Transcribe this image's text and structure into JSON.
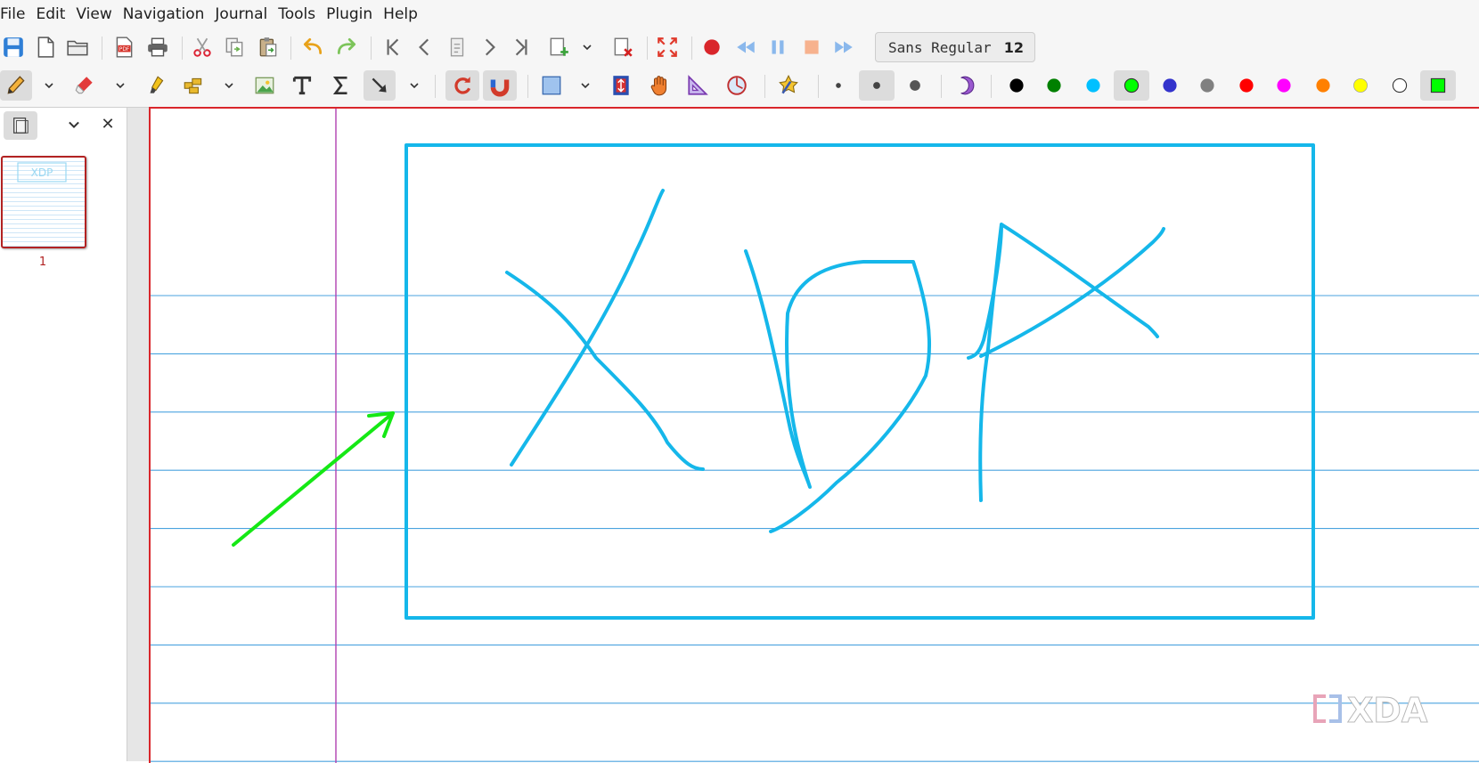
{
  "menu": [
    "File",
    "Edit",
    "View",
    "Navigation",
    "Journal",
    "Tools",
    "Plugin",
    "Help"
  ],
  "toolbar_main": {
    "buttons": [
      "save-icon",
      "new-document-icon",
      "open-folder-icon",
      "export-pdf-icon",
      "print-icon",
      "cut-icon",
      "copy-icon",
      "paste-icon",
      "undo-icon",
      "redo-icon",
      "first-page-icon",
      "previous-page-icon",
      "goto-page-icon",
      "next-page-icon",
      "last-page-icon",
      "add-page-icon",
      "delete-page-icon",
      "fullscreen-icon",
      "record-icon",
      "rewind-icon",
      "pause-icon",
      "stop-icon",
      "fast-forward-icon"
    ],
    "font_name": "Sans Regular",
    "font_size": "12"
  },
  "toolbar_tools": {
    "tools": [
      "pen-tool-icon",
      "eraser-tool-icon",
      "highlighter-tool-icon",
      "select-region-icon",
      "insert-image-icon",
      "text-tool-icon",
      "latex-tool-icon",
      "arrow-tool-icon",
      "rotation-snapping-icon",
      "grid-snapping-icon",
      "rectangle-tool-icon",
      "vertical-space-icon",
      "hand-tool-icon",
      "setsquare-icon",
      "compass-icon",
      "fill-tool-icon"
    ],
    "active_tools": [
      "arrow-tool-icon",
      "rotation-snapping-icon",
      "grid-snapping-icon"
    ],
    "thickness": [
      "fine",
      "medium",
      "thick"
    ],
    "active_thickness": "medium",
    "colors": [
      {
        "name": "black",
        "hex": "#000000"
      },
      {
        "name": "green",
        "hex": "#008000"
      },
      {
        "name": "light-blue",
        "hex": "#00c0ff"
      },
      {
        "name": "light-green",
        "hex": "#00ff00"
      },
      {
        "name": "blue",
        "hex": "#3333cc"
      },
      {
        "name": "gray",
        "hex": "#808080"
      },
      {
        "name": "red",
        "hex": "#ff0000"
      },
      {
        "name": "magenta",
        "hex": "#ff00ff"
      },
      {
        "name": "orange",
        "hex": "#ff8000"
      },
      {
        "name": "yellow",
        "hex": "#ffff00"
      },
      {
        "name": "white",
        "hex": "#ffffff"
      }
    ],
    "selected_color": "light-green",
    "custom_color": "#00ff00"
  },
  "sidebar": {
    "pages": [
      {
        "label": "1",
        "preview_text": "XDP"
      }
    ]
  },
  "page": {
    "background": "ruled",
    "rule_color": "#4aa3df",
    "margin_color": "#b040b0",
    "strokes": [
      {
        "name": "rectangle-stroke",
        "color": "#15b7ea"
      },
      {
        "name": "letter-x-stroke",
        "color": "#15b7ea"
      },
      {
        "name": "letter-d-stroke",
        "color": "#15b7ea"
      },
      {
        "name": "letter-p-stroke",
        "color": "#15b7ea"
      },
      {
        "name": "arrow-stroke",
        "color": "#15e815"
      }
    ]
  },
  "watermark": {
    "text": "XDA"
  }
}
